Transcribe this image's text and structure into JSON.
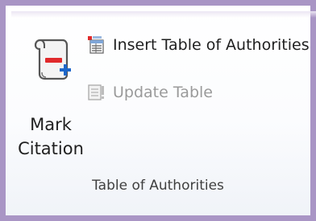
{
  "ribbon_group": {
    "label": "Table of Authorities",
    "mark_citation": {
      "label": "Mark\nCitation",
      "icon": "mark-citation-icon"
    },
    "insert_table": {
      "label": "Insert Table of Authorities",
      "icon": "insert-table-of-authorities-icon",
      "enabled": true
    },
    "update_table": {
      "label": "Update Table",
      "icon": "update-table-icon",
      "enabled": false
    }
  },
  "colors": {
    "frame_border": "#a995c5",
    "text": "#1f1f1f",
    "disabled_text": "#9a9a9a",
    "accent_red": "#e0292b",
    "accent_blue": "#1d66c9"
  }
}
